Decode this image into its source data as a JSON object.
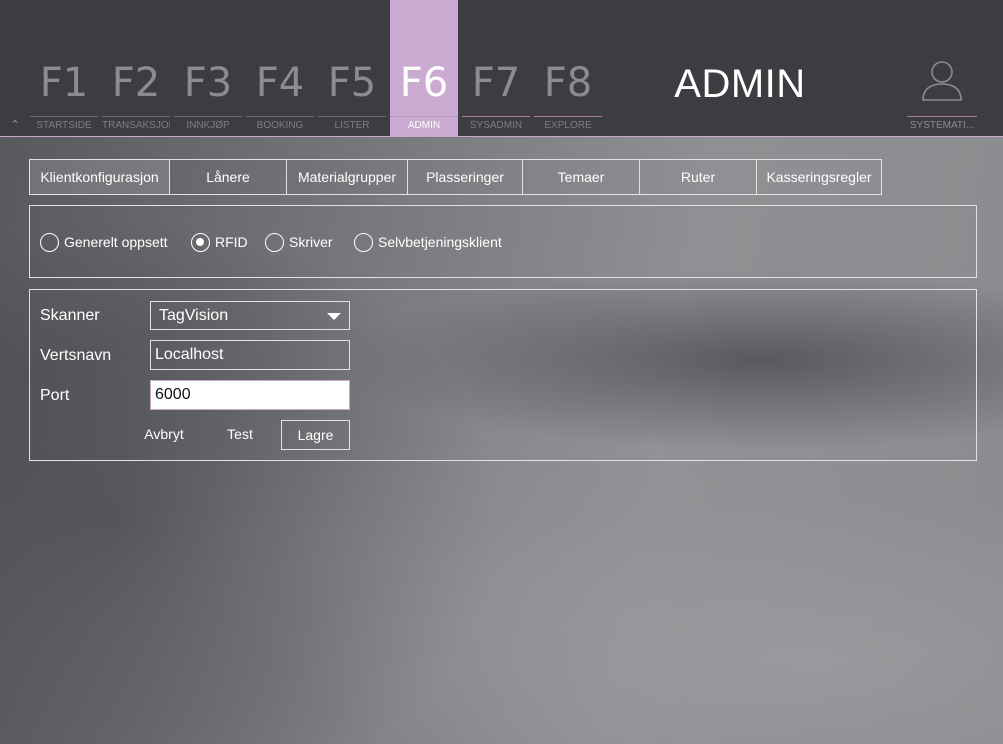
{
  "fkeys": [
    {
      "key": "F1",
      "label": "STARTSIDE"
    },
    {
      "key": "F2",
      "label": "TRANSAKSJON"
    },
    {
      "key": "F3",
      "label": "INNKJØP"
    },
    {
      "key": "F4",
      "label": "BOOKING"
    },
    {
      "key": "F5",
      "label": "LISTER"
    },
    {
      "key": "F6",
      "label": "ADMIN"
    },
    {
      "key": "F7",
      "label": "SYSADMIN"
    },
    {
      "key": "F8",
      "label": "EXPLORE"
    }
  ],
  "active_fkey": "F6",
  "module_title": "ADMIN",
  "user": {
    "label": "SYSTEMATI...",
    "icon": "user-icon"
  },
  "colors": {
    "accent": "#caaad0",
    "topbar": "#3b3d41",
    "pink_line": "#b07a99"
  },
  "tabs": [
    {
      "label": "Klientkonfigurasjon",
      "active": true
    },
    {
      "label": "Lånere"
    },
    {
      "label": "Materialgrupper"
    },
    {
      "label": "Plasseringer"
    },
    {
      "label": "Temaer"
    },
    {
      "label": "Ruter"
    },
    {
      "label": "Kasseringsregler"
    }
  ],
  "config_options": [
    {
      "label": "Generelt oppsett",
      "checked": false
    },
    {
      "label": "RFID",
      "checked": true
    },
    {
      "label": "Skriver",
      "checked": false
    },
    {
      "label": "Selvbetjeningsklient",
      "checked": false
    }
  ],
  "form": {
    "scanner_label": "Skanner",
    "scanner_value": "TagVision",
    "hostname_label": "Vertsnavn",
    "hostname_value": "Localhost",
    "port_label": "Port",
    "port_value": "6000",
    "cancel_label": "Avbryt",
    "test_label": "Test",
    "save_label": "Lagre"
  }
}
